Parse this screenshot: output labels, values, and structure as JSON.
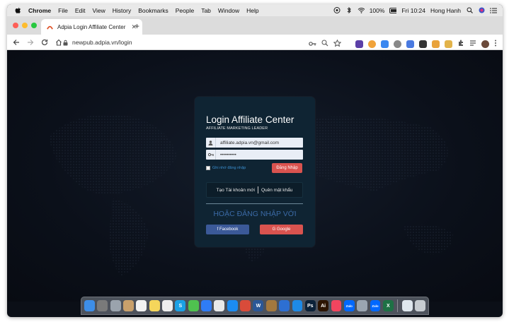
{
  "menubar": {
    "app_name": "Chrome",
    "items": [
      "File",
      "Edit",
      "View",
      "History",
      "Bookmarks",
      "People",
      "Tab",
      "Window",
      "Help"
    ],
    "battery": "100%",
    "clock": "Fri 10:24",
    "user": "Hong Hanh"
  },
  "browser": {
    "tab_title": "Adpia Login Affiliate Center",
    "url": "newpub.adpia.vn/login"
  },
  "login": {
    "title": "Login Affiliate Center",
    "subtitle": "AFFILIATE MARKETING LEADER",
    "email_value": "affiliate.adpia.vn@gmail.com",
    "password_value": "••••••••••",
    "remember_label": "Ghi nhớ đăng nhập",
    "login_button": "Đăng Nhập",
    "create_account": "Tạo Tài khoản mới",
    "forgot_password": "Quên mật khẩu",
    "or_login_with": "HOẶC ĐĂNG NHẬP VỚI",
    "facebook_button": "f Facebook",
    "google_button": "G Google"
  },
  "dock": {
    "apps": [
      {
        "name": "finder",
        "color": "#3d8ee8",
        "glyph": ""
      },
      {
        "name": "launchpad",
        "color": "#7a7a7a",
        "glyph": ""
      },
      {
        "name": "safari-alt",
        "color": "#9aa3ad",
        "glyph": ""
      },
      {
        "name": "contacts",
        "color": "#c9a06b",
        "glyph": ""
      },
      {
        "name": "calendar",
        "color": "#f2f2f2",
        "glyph": ""
      },
      {
        "name": "notes",
        "color": "#f5d65b",
        "glyph": ""
      },
      {
        "name": "reminders",
        "color": "#eeeeee",
        "glyph": ""
      },
      {
        "name": "skype",
        "color": "#1aa1e6",
        "glyph": "S"
      },
      {
        "name": "messages",
        "color": "#4fc24f",
        "glyph": ""
      },
      {
        "name": "messenger",
        "color": "#2f7cf6",
        "glyph": ""
      },
      {
        "name": "photos",
        "color": "#e9e9e9",
        "glyph": ""
      },
      {
        "name": "app-store",
        "color": "#1b8cf2",
        "glyph": ""
      },
      {
        "name": "tool-red",
        "color": "#d94b3a",
        "glyph": ""
      },
      {
        "name": "word",
        "color": "#2b5797",
        "glyph": "W"
      },
      {
        "name": "notebook",
        "color": "#a3783e",
        "glyph": ""
      },
      {
        "name": "preview",
        "color": "#2d6fd2",
        "glyph": ""
      },
      {
        "name": "safari",
        "color": "#1e8ae6",
        "glyph": ""
      },
      {
        "name": "photoshop",
        "color": "#0b2138",
        "glyph": "Ps"
      },
      {
        "name": "illustrator",
        "color": "#2c1400",
        "glyph": "Ai"
      },
      {
        "name": "music",
        "color": "#f2455f",
        "glyph": ""
      },
      {
        "name": "zalo",
        "color": "#0068ff",
        "glyph": "Zalo"
      },
      {
        "name": "screenshot",
        "color": "#9aa5b1",
        "glyph": ""
      },
      {
        "name": "zalo-2",
        "color": "#0068ff",
        "glyph": "Zalo"
      },
      {
        "name": "excel",
        "color": "#1e7145",
        "glyph": "X"
      },
      {
        "name": "folder",
        "color": "#dfe7ee",
        "glyph": ""
      },
      {
        "name": "trash",
        "color": "#c7ccd1",
        "glyph": ""
      }
    ]
  }
}
